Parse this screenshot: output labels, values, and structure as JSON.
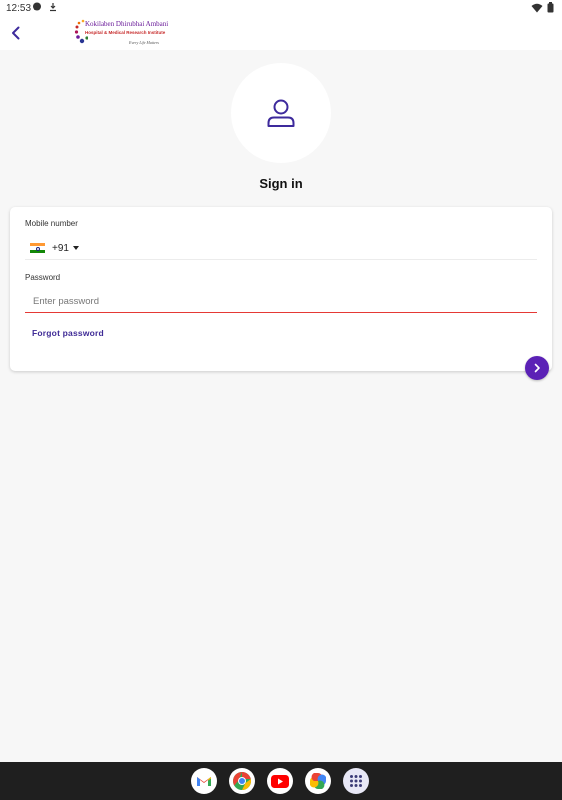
{
  "status_bar": {
    "time": "12:53",
    "left_icons": [
      "chat-bubble-icon",
      "download-icon"
    ],
    "right_icons": [
      "wifi-icon",
      "battery-icon"
    ]
  },
  "app_bar": {
    "back_icon": "chevron-left-icon",
    "logo": {
      "title": "Kokilaben Dhirubhai Ambani",
      "subtitle": "Hospital & Medical Research Institute",
      "tagline": "Every Life Matters"
    }
  },
  "header": {
    "avatar_icon": "person-icon",
    "title": "Sign in"
  },
  "form": {
    "mobile": {
      "label": "Mobile number",
      "country_flag": "india-flag-icon",
      "country_code": "+91",
      "dropdown_icon": "caret-down-icon",
      "value": ""
    },
    "password": {
      "label": "Password",
      "placeholder": "Enter password",
      "value": ""
    },
    "forgot_password": "Forgot password",
    "submit_icon": "chevron-right-icon"
  },
  "taskbar": {
    "apps": [
      "gmail-icon",
      "chrome-icon",
      "youtube-icon",
      "photos-icon",
      "app-drawer-icon"
    ]
  },
  "colors": {
    "accent": "#5b21b6",
    "link": "#3f2b96",
    "error_underline": "#e53935",
    "background": "#f7f7f7",
    "taskbar": "#1f1f1f"
  }
}
